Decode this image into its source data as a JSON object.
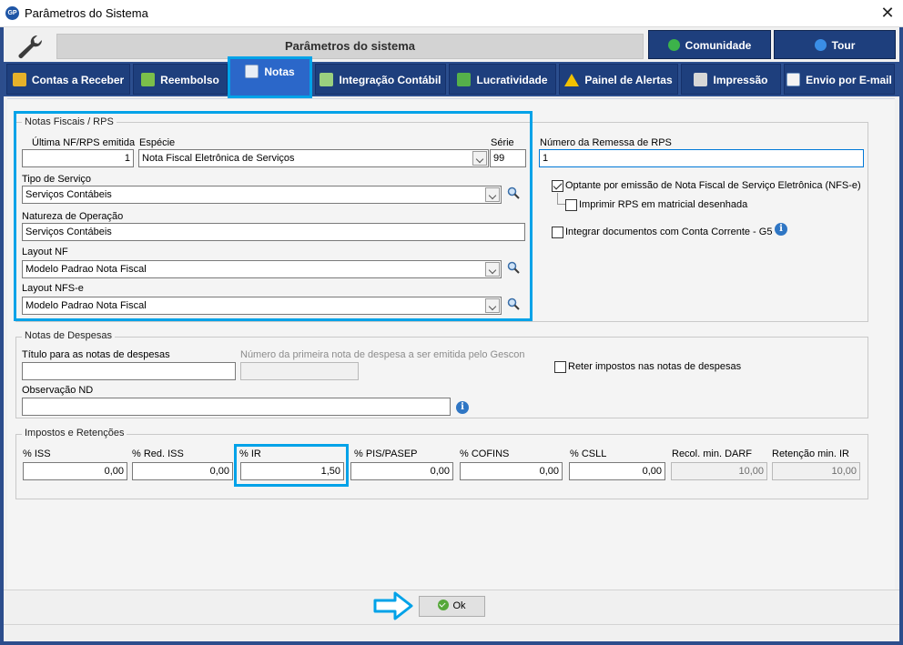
{
  "window": {
    "title": "Parâmetros do Sistema",
    "app_icon_text": "GP"
  },
  "header": {
    "title": "Parâmetros do sistema",
    "buttons": [
      {
        "label": "Comunidade",
        "icon": "community-icon"
      },
      {
        "label": "Tour",
        "icon": "globe-icon"
      }
    ]
  },
  "tabs": [
    {
      "label": "Contas a Receber",
      "icon": "coins-icon"
    },
    {
      "label": "Reembolso",
      "icon": "cart-icon"
    },
    {
      "label": "Notas",
      "icon": "documents-icon",
      "active": true
    },
    {
      "label": "Integração Contábil",
      "icon": "integration-icon"
    },
    {
      "label": "Lucratividade",
      "icon": "profit-icon"
    },
    {
      "label": "Painel de Alertas",
      "icon": "warning-icon"
    },
    {
      "label": "Impressão",
      "icon": "printer-icon"
    },
    {
      "label": "Envio por E-mail",
      "icon": "email-icon"
    }
  ],
  "notas_fiscais": {
    "legend": "Notas Fiscais / RPS",
    "ultima_nf_label": "Última NF/RPS emitida",
    "ultima_nf_value": "1",
    "especie_label": "Espécie",
    "especie_value": "Nota Fiscal Eletrônica de Serviços",
    "serie_label": "Série",
    "serie_value": "99",
    "tipo_servico_label": "Tipo de Serviço",
    "tipo_servico_value": "Serviços Contábeis",
    "natureza_label": "Natureza de Operação",
    "natureza_value": "Serviços Contábeis",
    "layout_nf_label": "Layout NF",
    "layout_nf_value": "Modelo Padrao Nota Fiscal",
    "layout_nfse_label": "Layout NFS-e",
    "layout_nfse_value": "Modelo Padrao Nota Fiscal"
  },
  "rps": {
    "remessa_label": "Número da Remessa de RPS",
    "remessa_value": "1",
    "optante_label": "Optante por emissão de Nota Fiscal de Serviço Eletrônica (NFS-e)",
    "optante_checked": true,
    "imprimir_label": "Imprimir RPS em matricial desenhada",
    "imprimir_checked": false,
    "integrar_label": "Integrar documentos com Conta Corrente - G5",
    "integrar_checked": false
  },
  "despesas": {
    "legend": "Notas de Despesas",
    "titulo_label": "Título para as notas de despesas",
    "titulo_value": "",
    "numero_label": "Número da primeira nota de despesa a ser emitida pelo Gescon",
    "numero_value": "",
    "reter_label": "Reter impostos nas notas de despesas",
    "reter_checked": false,
    "observacao_label": "Observação ND",
    "observacao_value": ""
  },
  "impostos": {
    "legend": "Impostos e Retenções",
    "fields": [
      {
        "label": "% ISS",
        "value": "0,00"
      },
      {
        "label": "% Red. ISS",
        "value": "0,00"
      },
      {
        "label": "% IR",
        "value": "1,50"
      },
      {
        "label": "% PIS/PASEP",
        "value": "0,00"
      },
      {
        "label": "% COFINS",
        "value": "0,00"
      },
      {
        "label": "% CSLL",
        "value": "0,00"
      },
      {
        "label": "Recol. min. DARF",
        "value": "10,00"
      },
      {
        "label": "Retenção min. IR",
        "value": "10,00"
      }
    ]
  },
  "footer": {
    "ok_label": "Ok"
  },
  "colors": {
    "frame": "#2c4d8c",
    "tab": "#1e3f7d",
    "tab_active": "#2b67c9",
    "highlight": "#00a2e8"
  }
}
